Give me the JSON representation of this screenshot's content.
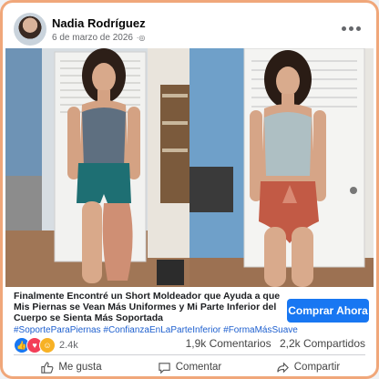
{
  "post": {
    "author": "Nadia Rodríguez",
    "date": "6 de marzo de 2026",
    "privacy_icon": "globe-icon"
  },
  "ad": {
    "headline": "Finalmente Encontré un Short Moldeador que Ayuda a que Mis Piernas se Vean Más Uniformes y Mi Parte Inferior del Cuerpo se Sienta Más Soportada",
    "hashtags": "#SoporteParaPiernas #ConfianzaEnLaParteInferior #FormaMásSuave",
    "cta_label": "Comprar Ahora"
  },
  "stats": {
    "reactions": [
      {
        "type": "like",
        "icon": "thumbs-up-icon"
      },
      {
        "type": "love",
        "icon": "heart-icon"
      },
      {
        "type": "care",
        "icon": "care-emoji-icon"
      }
    ],
    "reaction_count": "2.4k",
    "comments": "1,9k Comentarios",
    "shares": "2,2k Compartidos"
  },
  "actions": {
    "like": "Me gusta",
    "comment": "Comentar",
    "share": "Compartir"
  },
  "colors": {
    "frame_border": "#f0a77a",
    "cta": "#1877f2",
    "hashtag": "#1d5fcf"
  }
}
